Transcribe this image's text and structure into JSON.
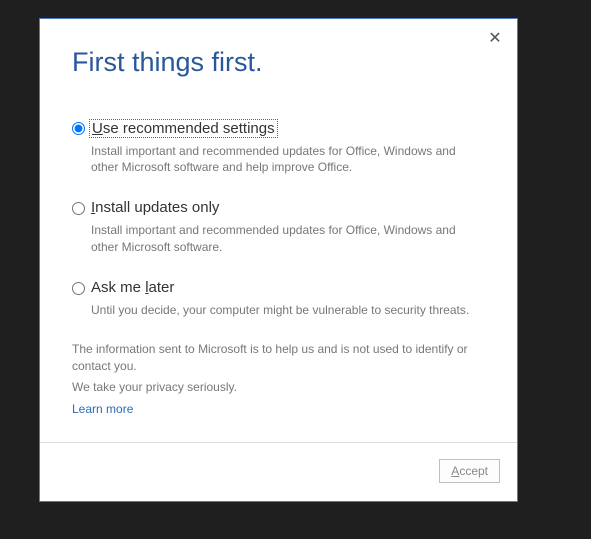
{
  "title": "First things first.",
  "options": [
    {
      "labelPrefix": "U",
      "labelRest": "se recommended settings",
      "desc": "Install important and recommended updates for Office, Windows and other Microsoft software and help improve Office.",
      "selected": true,
      "focused": true
    },
    {
      "labelPrefix": "I",
      "labelRest": "nstall updates only",
      "desc": "Install important and recommended updates for Office, Windows and other Microsoft software.",
      "selected": false,
      "focused": false
    },
    {
      "labelPrefix": "Ask me ",
      "labelMid": "l",
      "labelRest": "ater",
      "desc": "Until you decide, your computer might be vulnerable to security threats.",
      "selected": false,
      "focused": false
    }
  ],
  "footer": {
    "line1": "The information sent to Microsoft is to help us and is not used to identify or contact you.",
    "line2": "We take your privacy seriously.",
    "learn": "Learn more"
  },
  "accept": {
    "prefix": "A",
    "rest": "ccept"
  },
  "close": "✕"
}
